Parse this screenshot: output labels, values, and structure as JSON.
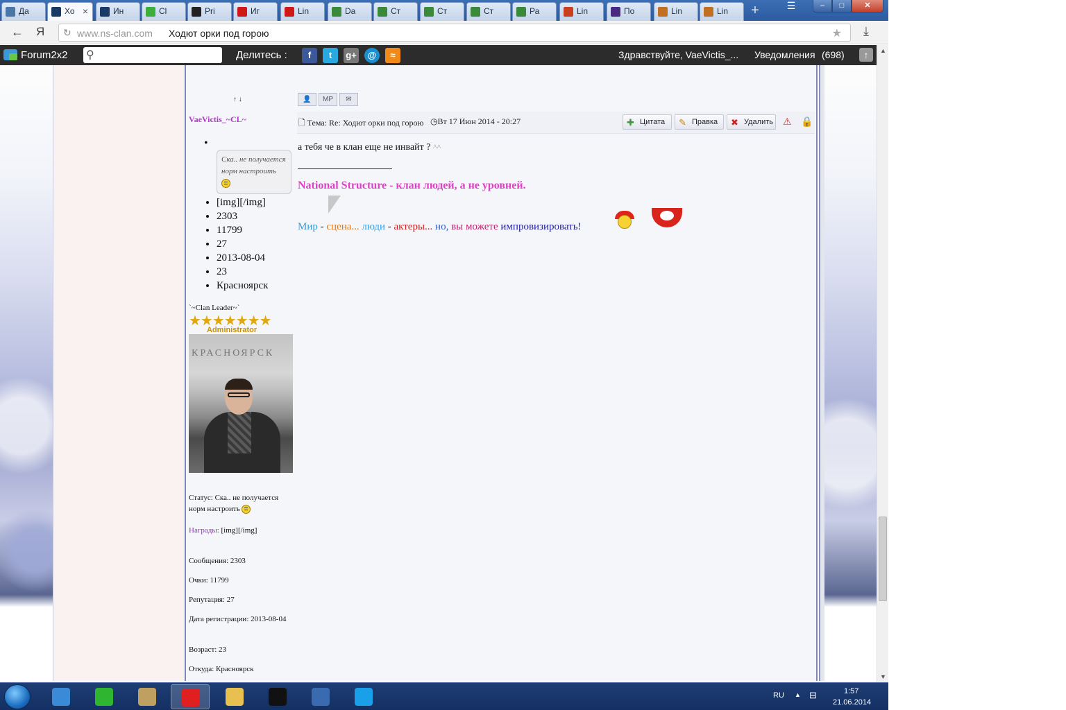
{
  "browser": {
    "tabs": [
      {
        "label": "Да",
        "icon": "vk-icon",
        "color": "#4a76a8"
      },
      {
        "label": "Хо",
        "icon": "ns-clan-icon",
        "color": "#1a3a66",
        "active": true
      },
      {
        "label": "Ин",
        "icon": "ns-clan-icon",
        "color": "#1a3a66"
      },
      {
        "label": "Cl",
        "icon": "chat-icon",
        "color": "#3cae3c"
      },
      {
        "label": "Pri",
        "icon": "pw-icon",
        "color": "#222222"
      },
      {
        "label": "Иг",
        "icon": "power-icon",
        "color": "#d01818"
      },
      {
        "label": "Lin",
        "icon": "power-icon",
        "color": "#d01818"
      },
      {
        "label": "Da",
        "icon": "leaf-icon",
        "color": "#3a8a3a"
      },
      {
        "label": "Ст",
        "icon": "leaf-icon",
        "color": "#3a8a3a"
      },
      {
        "label": "Ст",
        "icon": "leaf-icon",
        "color": "#3a8a3a"
      },
      {
        "label": "Ст",
        "icon": "leaf-icon",
        "color": "#3a8a3a"
      },
      {
        "label": "Ра",
        "icon": "leaf-icon",
        "color": "#3a8a3a"
      },
      {
        "label": "Lin",
        "icon": "fox-icon",
        "color": "#c84020"
      },
      {
        "label": "По",
        "icon": "book-icon",
        "color": "#4a2a80"
      },
      {
        "label": "Lin",
        "icon": "box-icon",
        "color": "#c07020"
      },
      {
        "label": "Lin",
        "icon": "box-icon",
        "color": "#c07020"
      }
    ],
    "close_tab": "×",
    "new_tab": "+",
    "back": "←",
    "yandex": "Я",
    "url_domain": "www.ns-clan.com",
    "page_title": "Ходют орки под горою",
    "window": {
      "menu": "☰",
      "minimize": "–",
      "maximize": "□",
      "close": "✕"
    }
  },
  "forumbar": {
    "name": "Forum2x2",
    "share_label": "Делитесь :",
    "social": {
      "facebook": "f",
      "twitter": "t",
      "gplus": "g+",
      "mail": "@",
      "rss": "≈"
    },
    "greeting": "Здравствуйте, VaeVictis_...",
    "notifications_label": "Уведомления",
    "notifications_count": "(698)",
    "up": "↑"
  },
  "post": {
    "nav_arrows": "↑ ↓",
    "profile_buttons": {
      "profile": "👤",
      "pm": "MP",
      "email": "✉"
    },
    "topic": "Тема: Re: Ходют орки под горою",
    "date": "Вт 17 Июн 2014 - 20:27",
    "buttons": {
      "quote": "Цитата",
      "edit": "Правка",
      "delete": "Удалить"
    },
    "text": "а тебя че в клан еще не инвайт ?",
    "text_suffix": "^^",
    "signature_title": "National Structure - клан людей, а не уровней.",
    "motto": [
      {
        "text": "Мир",
        "color": "#3a98d0"
      },
      {
        "text": " - ",
        "color": "#222222"
      },
      {
        "text": "сцена...",
        "color": "#e07a1a"
      },
      {
        "text": " люди",
        "color": "#3aa0e0"
      },
      {
        "text": " - ",
        "color": "#222222"
      },
      {
        "text": "актеры...",
        "color": "#d02020"
      },
      {
        "text": " но, ",
        "color": "#3060c8"
      },
      {
        "text": "вы можете",
        "color": "#c02070"
      },
      {
        "text": " импровизировать!",
        "color": "#2020a0"
      }
    ]
  },
  "author": {
    "name": "VaeVictis_~CL~",
    "status_bubble": "Ска.. не получается норм настроить",
    "info": [
      "[img][/img]",
      "2303",
      "11799",
      "27",
      "2013-08-04",
      "23",
      "Красноярск"
    ],
    "rank_title": "`~Clan Leader~`",
    "stars": "★★★★★★★",
    "rank_label": "Administrator",
    "avatar_caption": "КРАСНОЯРСК",
    "meta": {
      "status": "Статус: Ска.. не получается норм настроить",
      "awards_label": "Награды:",
      "awards_value": " [img][/img]",
      "posts": "Сообщения: 2303",
      "points": "Очки: 11799",
      "rep": "Репутация: 27",
      "reg": "Дата регистрации: 2013-08-04",
      "age": "Возраст: 23",
      "from": "Откуда: Красноярск"
    }
  },
  "taskbar": {
    "lang": "RU",
    "tray_arrow": "▲",
    "time": "1:57",
    "date": "21.06.2014",
    "items": [
      {
        "name": "download-icon",
        "color": "#3a8ad8"
      },
      {
        "name": "icq-icon",
        "color": "#2fb52f"
      },
      {
        "name": "paint-icon",
        "color": "#c0a060"
      },
      {
        "name": "yandex-browser-icon",
        "color": "#e02020",
        "active": true
      },
      {
        "name": "explorer-icon",
        "color": "#e8c050"
      },
      {
        "name": "pw-icon",
        "color": "#111111"
      },
      {
        "name": "ns-clan-icon",
        "color": "#3a6ab0"
      },
      {
        "name": "skype-icon",
        "color": "#1aa0e8"
      }
    ]
  }
}
